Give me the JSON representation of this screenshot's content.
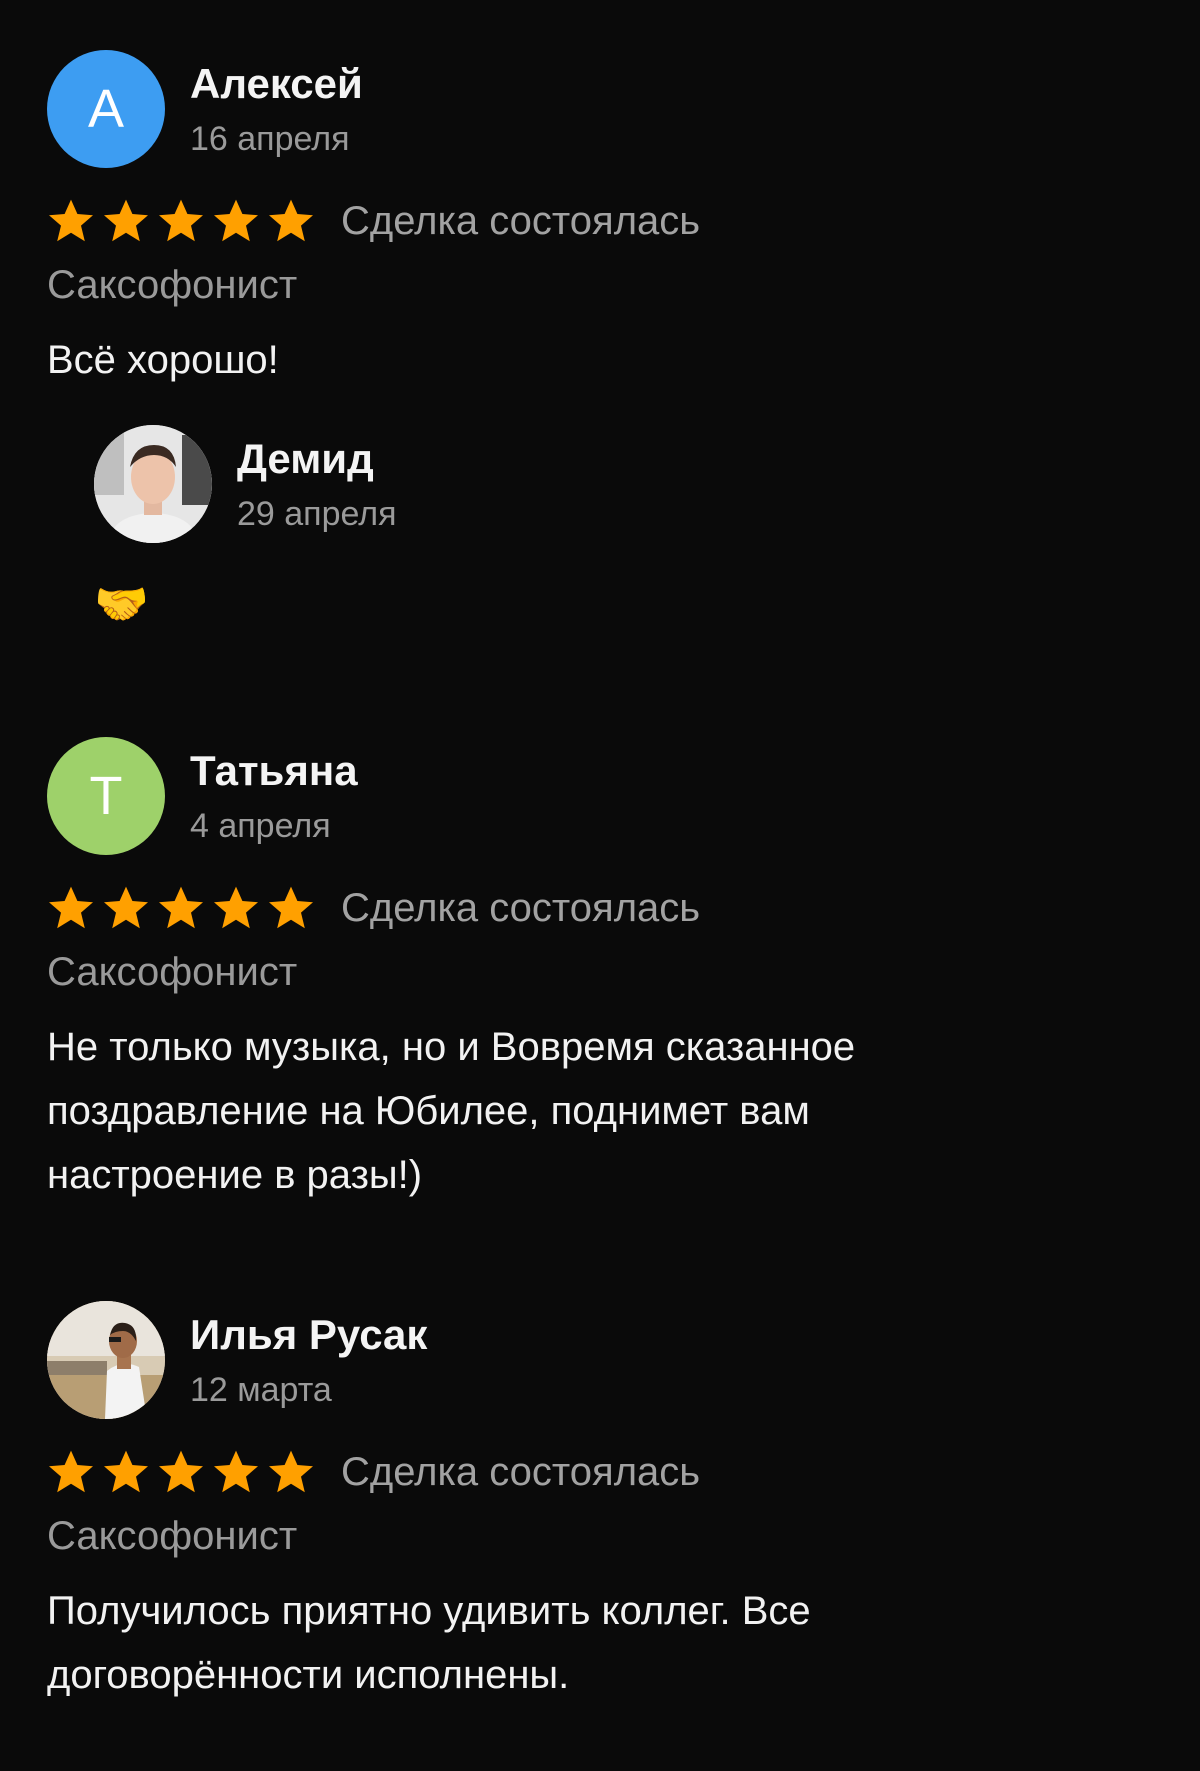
{
  "reviews": [
    {
      "author": "Алексей",
      "avatar_letter": "А",
      "avatar_color": "#3d9df2",
      "date": "16 апреля",
      "rating": 5,
      "deal_status": "Сделка состоялась",
      "service": "Саксофонист",
      "text": "Всё хорошо!",
      "reply": {
        "author": "Демид",
        "date": "29 апреля",
        "avatar": "photo",
        "text": "🤝"
      }
    },
    {
      "author": "Татьяна",
      "avatar_letter": "Т",
      "avatar_color": "#9ed16a",
      "date": "4 апреля",
      "rating": 5,
      "deal_status": "Сделка состоялась",
      "service": "Саксофонист",
      "text": "Не только музыка, но и Вовремя сказанное поздравление на Юбилее, поднимет вам настроение в разы!)"
    },
    {
      "author": "Илья Русак",
      "avatar": "photo",
      "date": "12 марта",
      "rating": 5,
      "deal_status": "Сделка состоялась",
      "service": "Саксофонист",
      "text": "Получилось приятно удивить коллег. Все договорённости исполнены."
    }
  ],
  "star_color": "#ffa000"
}
